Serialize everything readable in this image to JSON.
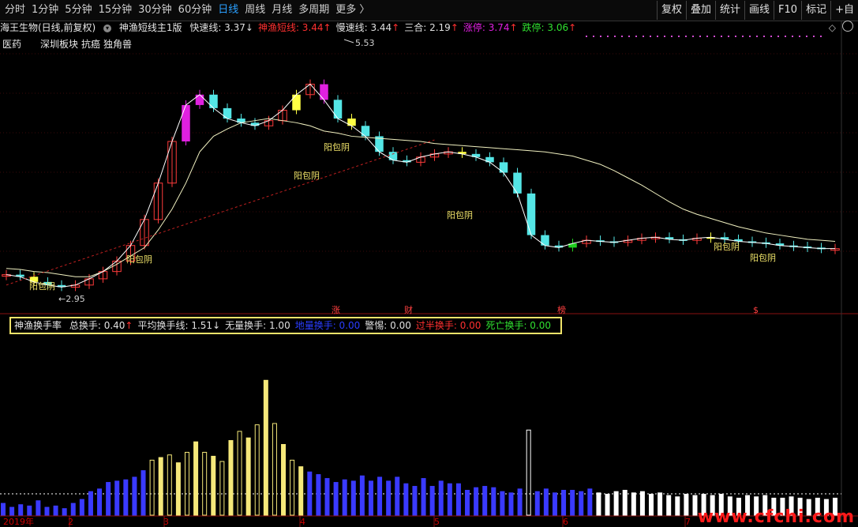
{
  "toolbar": {
    "periods": [
      "分时",
      "1分钟",
      "5分钟",
      "15分钟",
      "30分钟",
      "60分钟",
      "日线",
      "周线",
      "月线",
      "多周期",
      "更多 〉"
    ],
    "active_index": 6,
    "right_buttons": [
      "复权",
      "叠加",
      "统计",
      "画线",
      "F10",
      "标记",
      "+自"
    ]
  },
  "main_indicator": {
    "stock": "海王生物(日线,前复权)",
    "name": "神渔短线主1版",
    "items": [
      {
        "label": "快速线: 3.37",
        "arrow": "↓",
        "color": "#e0e0e0"
      },
      {
        "label": "神渔短线: 3.44",
        "arrow": "↑",
        "color": "#ff3030"
      },
      {
        "label": "慢速线: 3.44",
        "arrow": "↑",
        "color": "#e0e0e0"
      },
      {
        "label": "三合: 2.19",
        "arrow": "↑",
        "color": "#e0e0e0"
      },
      {
        "label": "涨停: 3.74",
        "arrow": "↑",
        "color": "#e020e0"
      },
      {
        "label": "跌停: 3.06",
        "arrow": "↑",
        "color": "#30e030"
      }
    ]
  },
  "categories": [
    "医药",
    "深圳板块",
    "抗癌",
    "独角兽"
  ],
  "price_labels": {
    "high": "5.53",
    "low": "2.95"
  },
  "pattern_label": "阳包阴",
  "sub_markers": [
    "涨",
    "财",
    "榜",
    "$"
  ],
  "sub_indicator": {
    "name": "神渔换手率",
    "items": [
      {
        "label": "总换手: 0.40",
        "arrow": "↑",
        "color": "#e0e0e0"
      },
      {
        "label": "平均换手线: 1.51",
        "arrow": "↓",
        "color": "#e0e0e0"
      },
      {
        "label": "无量换手: 1.00",
        "arrow": "",
        "color": "#e0e0e0"
      },
      {
        "label": "地量换手: 0.00",
        "arrow": "",
        "color": "#2a3dff"
      },
      {
        "label": "警惕: 0.00",
        "arrow": "",
        "color": "#e0e0e0"
      },
      {
        "label": "过半换手: 0.00",
        "arrow": "",
        "color": "#ff3030"
      },
      {
        "label": "死亡换手: 0.00",
        "arrow": "",
        "color": "#30e030"
      }
    ]
  },
  "x_axis": [
    "2019年",
    "2",
    "3",
    "4",
    "5",
    "6",
    "7"
  ],
  "watermark": "www.cfchi.com",
  "colors": {
    "up": "#ff3b3b",
    "down": "#54e6e6",
    "yellow": "#ffff44",
    "magenta": "#e020e0",
    "green": "#20d020",
    "ma": "#f0f0c0",
    "vol_yellow": "#f5e87a",
    "vol_blue": "#3a3aff"
  },
  "chart_data": [
    {
      "type": "line",
      "title": "",
      "series": [
        {
          "name": "慢速线",
          "values": [
            3.18,
            3.17,
            3.15,
            3.14,
            3.12,
            3.1,
            3.1,
            3.15,
            3.22,
            3.3,
            3.38,
            3.55,
            3.75,
            4.0,
            4.3,
            4.45,
            4.52,
            4.58,
            4.6,
            4.62,
            4.6,
            4.58,
            4.55,
            4.5,
            4.48,
            4.45,
            4.44,
            4.43,
            4.42,
            4.41,
            4.4,
            4.38,
            4.37,
            4.36,
            4.35,
            4.34,
            4.33,
            4.32,
            4.31,
            4.3,
            4.28,
            4.26,
            4.22,
            4.18,
            4.12,
            4.05,
            3.98,
            3.9,
            3.82,
            3.75,
            3.7,
            3.66,
            3.62,
            3.58,
            3.55,
            3.52,
            3.5,
            3.48,
            3.46,
            3.45,
            3.44
          ]
        },
        {
          "name": "快速线",
          "values": [
            3.12,
            3.1,
            3.05,
            3.02,
            3.0,
            3.02,
            3.08,
            3.15,
            3.25,
            3.4,
            3.65,
            4.0,
            4.4,
            4.75,
            4.85,
            4.72,
            4.62,
            4.58,
            4.55,
            4.6,
            4.7,
            4.85,
            4.95,
            4.8,
            4.62,
            4.55,
            4.45,
            4.3,
            4.22,
            4.2,
            4.25,
            4.28,
            4.3,
            4.28,
            4.25,
            4.2,
            4.1,
            3.9,
            3.5,
            3.4,
            3.38,
            3.42,
            3.45,
            3.44,
            3.43,
            3.45,
            3.47,
            3.48,
            3.46,
            3.45,
            3.47,
            3.48,
            3.46,
            3.44,
            3.43,
            3.42,
            3.4,
            3.39,
            3.38,
            3.37,
            3.37
          ]
        }
      ],
      "ylim": [
        2.8,
        5.7
      ]
    },
    {
      "type": "bar",
      "title": "",
      "values": [
        0.9,
        0.6,
        0.8,
        0.7,
        1.1,
        0.6,
        0.7,
        0.5,
        0.9,
        1.2,
        1.8,
        2.0,
        2.5,
        2.6,
        2.7,
        2.9,
        3.4,
        4.2,
        4.4,
        4.6,
        4.0,
        4.8,
        5.6,
        4.8,
        4.5,
        4.1,
        5.7,
        6.4,
        5.9,
        6.9,
        10.3,
        7.0,
        5.4,
        4.2,
        3.7,
        3.3,
        3.1,
        2.8,
        2.5,
        2.7,
        2.6,
        3.0,
        2.6,
        2.9,
        2.6,
        2.9,
        2.4,
        2.2,
        2.8,
        2.2,
        2.6,
        2.4,
        2.4,
        1.9,
        2.1,
        2.2,
        2.1,
        1.8,
        1.7,
        2.0,
        6.5,
        1.8,
        2.0,
        1.7,
        1.9,
        1.9,
        1.8,
        2.0,
        1.7,
        1.6,
        1.8,
        1.9,
        1.7,
        1.8,
        1.6,
        1.7,
        1.5,
        1.4,
        1.6,
        1.5,
        1.6,
        1.5,
        1.6,
        1.4,
        1.3,
        1.5,
        1.4,
        1.5,
        1.3,
        1.3,
        1.4,
        1.3,
        1.2,
        1.3,
        1.2,
        1.3
      ],
      "ylim": [
        0,
        14
      ]
    }
  ]
}
